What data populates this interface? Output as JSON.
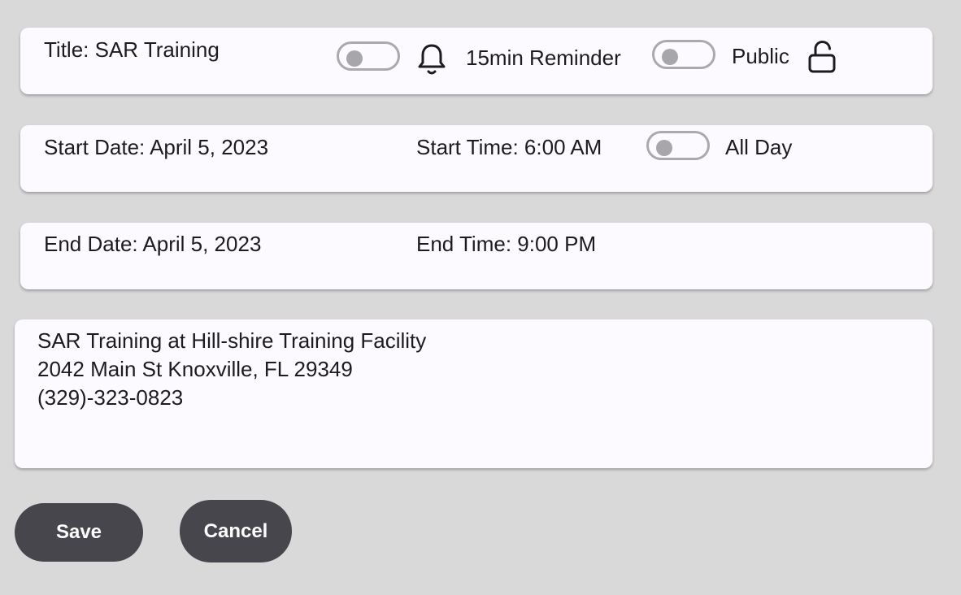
{
  "event": {
    "title": "Title: SAR Training",
    "reminder_label": "15min Reminder",
    "public_label": "Public",
    "reminder_enabled": false,
    "public_enabled": false
  },
  "start": {
    "date": "Start Date: April 5, 2023",
    "time": "Start Time: 6:00 AM",
    "all_day_label": "All Day",
    "all_day_enabled": false
  },
  "end": {
    "date": "End Date: April 5, 2023",
    "time": "End Time: 9:00 PM"
  },
  "notes": {
    "line1": "SAR Training at Hill-shire Training Facility",
    "line2": "2042 Main St Knoxville, FL 29349",
    "line3": "(329)-323-0823"
  },
  "actions": {
    "save_label": "Save",
    "cancel_label": "Cancel"
  }
}
